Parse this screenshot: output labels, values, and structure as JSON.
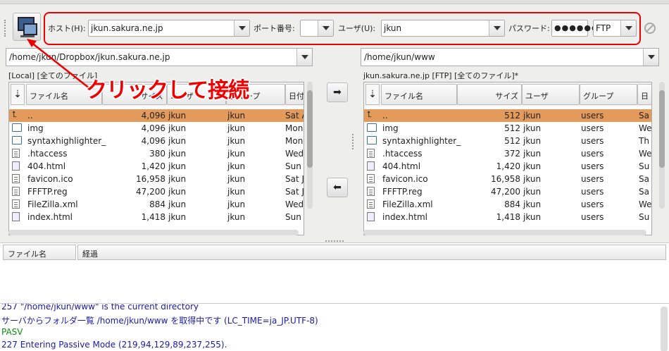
{
  "toolbar": {
    "host_label": "ホスト(H):",
    "host_value": "jkun.sakura.ne.jp",
    "port_label": "ポート番号:",
    "port_value": "",
    "user_label": "ユーザ(U):",
    "user_value": "jkun",
    "password_label": "パスワード:",
    "password_dots": "●●●●●●●",
    "protocol": "FTP"
  },
  "local": {
    "path": "/home/jkun/Dropbox/jkun.sakura.ne.jp",
    "label": "[Local] [全てのファイル]",
    "columns": [
      "ファイル名",
      "サイズ",
      "ユーザ",
      "グループ",
      "日付"
    ],
    "rows": [
      {
        "name": "..",
        "size": "4,096",
        "user": "jkun",
        "group": "jkun",
        "date": "Sat A",
        "icon": "up"
      },
      {
        "name": "img",
        "size": "4,096",
        "user": "jkun",
        "group": "jkun",
        "date": "Mon",
        "icon": "folder"
      },
      {
        "name": "syntaxhighlighter_",
        "size": "4,096",
        "user": "jkun",
        "group": "jkun",
        "date": "Mon",
        "icon": "folder"
      },
      {
        "name": ".htaccess",
        "size": "380",
        "user": "jkun",
        "group": "jkun",
        "date": "Wed",
        "icon": "file"
      },
      {
        "name": "404.html",
        "size": "1,420",
        "user": "jkun",
        "group": "jkun",
        "date": "Sun J",
        "icon": "web"
      },
      {
        "name": "favicon.ico",
        "size": "16,958",
        "user": "jkun",
        "group": "jkun",
        "date": "Sat J",
        "icon": "file"
      },
      {
        "name": "FFFTP.reg",
        "size": "47,200",
        "user": "jkun",
        "group": "jkun",
        "date": "Sat J",
        "icon": "file"
      },
      {
        "name": "FileZilla.xml",
        "size": "884",
        "user": "jkun",
        "group": "jkun",
        "date": "Wed",
        "icon": "file"
      },
      {
        "name": "index.html",
        "size": "1,418",
        "user": "jkun",
        "group": "jkun",
        "date": "Sun J",
        "icon": "web"
      }
    ]
  },
  "remote": {
    "path": "/home/jkun/www",
    "label": "jkun.sakura.ne.jp [FTP] [全てのファイル]*",
    "columns": [
      "ファイル名",
      "サイズ",
      "ユーザ",
      "グループ",
      "日"
    ],
    "rows": [
      {
        "name": "..",
        "size": "512",
        "user": "jkun",
        "group": "users",
        "date": "Sa",
        "icon": "up"
      },
      {
        "name": "img",
        "size": "512",
        "user": "jkun",
        "group": "users",
        "date": "We",
        "icon": "folder"
      },
      {
        "name": "syntaxhighlighter_",
        "size": "512",
        "user": "jkun",
        "group": "users",
        "date": "Th",
        "icon": "folder"
      },
      {
        "name": ".htaccess",
        "size": "372",
        "user": "jkun",
        "group": "users",
        "date": "We",
        "icon": "file"
      },
      {
        "name": "404.html",
        "size": "1,420",
        "user": "jkun",
        "group": "users",
        "date": "Su",
        "icon": "web"
      },
      {
        "name": "favicon.ico",
        "size": "16,958",
        "user": "jkun",
        "group": "users",
        "date": "Sa",
        "icon": "file"
      },
      {
        "name": "FFFTP.reg",
        "size": "47,200",
        "user": "jkun",
        "group": "users",
        "date": "Sa",
        "icon": "file"
      },
      {
        "name": "FileZilla.xml",
        "size": "884",
        "user": "jkun",
        "group": "users",
        "date": "We",
        "icon": "file"
      },
      {
        "name": "index.html",
        "size": "1,418",
        "user": "jkun",
        "group": "users",
        "date": "Su",
        "icon": "web"
      }
    ]
  },
  "transfer": {
    "upload_icon": "right-arrow-icon",
    "download_icon": "left-arrow-icon"
  },
  "queue": {
    "col_filename": "ファイル名",
    "col_progress": "経過"
  },
  "log": {
    "lines": [
      {
        "text": "257 \"/home/jkun/www\" is the current directory",
        "color": "#1a1aa8"
      },
      {
        "text": "サーバからフォルダ一覧 /home/jkun/www を取得中です (LC_TIME=ja_JP.UTF-8)",
        "color": "#1a1aa8"
      },
      {
        "text": "PASV",
        "color": "#128a12"
      },
      {
        "text": "227 Entering Passive Mode (219,94,129,89,237,255).",
        "color": "#1a1aa8"
      }
    ]
  },
  "annotation": {
    "text": "クリックして接続",
    "color": "#e00000"
  }
}
